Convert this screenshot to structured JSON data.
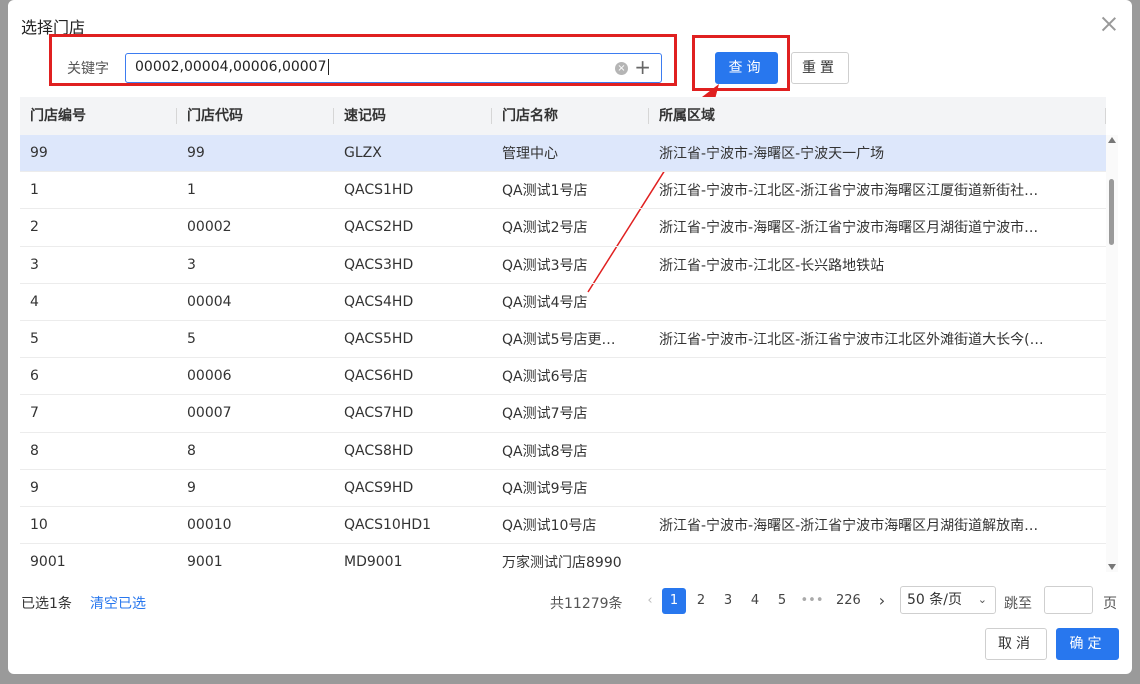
{
  "dialog": {
    "title": "选择门店"
  },
  "search": {
    "label": "关键字",
    "value": "00002,00004,00006,00007",
    "query_label": "查询",
    "reset_label": "重置"
  },
  "table": {
    "columns": [
      "门店编号",
      "门店代码",
      "速记码",
      "门店名称",
      "所属区域"
    ],
    "rows": [
      [
        "99",
        "99",
        "GLZX",
        "管理中心",
        "浙江省-宁波市-海曙区-宁波天一广场"
      ],
      [
        "1",
        "1",
        "QACS1HD",
        "QA测试1号店",
        "浙江省-宁波市-江北区-浙江省宁波市海曙区江厦街道新街社…"
      ],
      [
        "2",
        "00002",
        "QACS2HD",
        "QA测试2号店",
        "浙江省-宁波市-海曙区-浙江省宁波市海曙区月湖街道宁波市…"
      ],
      [
        "3",
        "3",
        "QACS3HD",
        "QA测试3号店",
        "浙江省-宁波市-江北区-长兴路地铁站"
      ],
      [
        "4",
        "00004",
        "QACS4HD",
        "QA测试4号店",
        ""
      ],
      [
        "5",
        "5",
        "QACS5HD",
        "QA测试5号店更…",
        "浙江省-宁波市-江北区-浙江省宁波市江北区外滩街道大长今(…"
      ],
      [
        "6",
        "00006",
        "QACS6HD",
        "QA测试6号店",
        ""
      ],
      [
        "7",
        "00007",
        "QACS7HD",
        "QA测试7号店",
        ""
      ],
      [
        "8",
        "8",
        "QACS8HD",
        "QA测试8号店",
        ""
      ],
      [
        "9",
        "9",
        "QACS9HD",
        "QA测试9号店",
        ""
      ],
      [
        "10",
        "00010",
        "QACS10HD1",
        "QA测试10号店",
        "浙江省-宁波市-海曙区-浙江省宁波市海曙区月湖街道解放南…"
      ],
      [
        "9001",
        "9001",
        "MD9001",
        "万家测试门店8990",
        ""
      ]
    ]
  },
  "footer": {
    "selected": "已选1条",
    "clear": "清空已选",
    "total": "共11279条",
    "pages": [
      "1",
      "2",
      "3",
      "4",
      "5",
      "•••",
      "226"
    ],
    "page_size": "50 条/页",
    "jump_label": "跳至",
    "page_unit": "页",
    "cancel_label": "取消",
    "confirm_label": "确定"
  },
  "colors": {
    "primary": "#2877ee",
    "annotation": "#e02020",
    "selected_row": "#dde7fb"
  }
}
